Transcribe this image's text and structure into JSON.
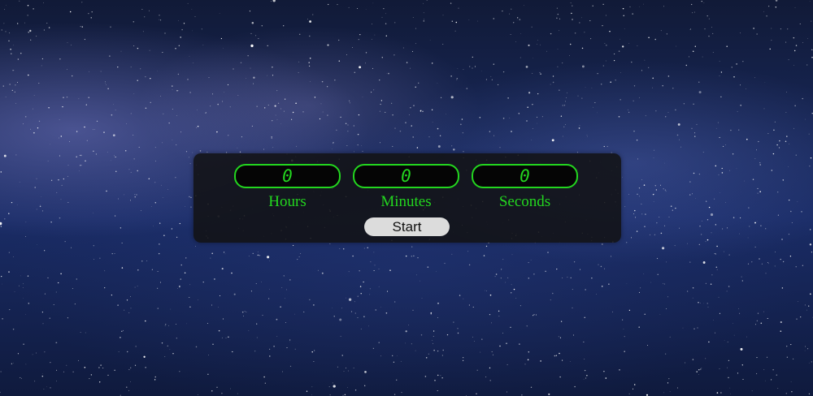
{
  "background": {
    "description_icon": "starfield-image"
  },
  "timer": {
    "hours": {
      "value": "0",
      "label": "Hours"
    },
    "minutes": {
      "value": "0",
      "label": "Minutes"
    },
    "seconds": {
      "value": "0",
      "label": "Seconds"
    },
    "start_label": "Start"
  },
  "colors": {
    "accent": "#23d61f",
    "panel": "#121214",
    "button": "#dcdcdc"
  }
}
